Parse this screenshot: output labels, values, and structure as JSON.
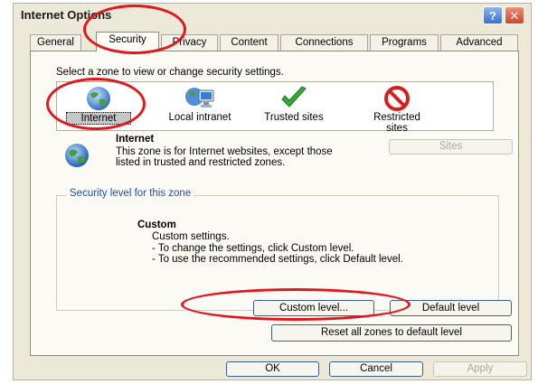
{
  "window": {
    "title": "Internet Options",
    "help_label": "?",
    "close_label": "✕"
  },
  "tabs": [
    {
      "label": "General"
    },
    {
      "label": "Security",
      "active": true
    },
    {
      "label": "Privacy"
    },
    {
      "label": "Content"
    },
    {
      "label": "Connections"
    },
    {
      "label": "Programs"
    },
    {
      "label": "Advanced"
    }
  ],
  "security": {
    "prompt": "Select a zone to view or change security settings.",
    "zones": [
      {
        "label": "Internet",
        "icon": "globe-icon",
        "selected": true
      },
      {
        "label": "Local intranet",
        "icon": "computer-network-icon"
      },
      {
        "label": "Trusted sites",
        "icon": "green-checkmark-icon"
      },
      {
        "label": "Restricted sites",
        "icon": "red-no-entry-icon"
      }
    ],
    "info_title": "Internet",
    "info_text": "This zone is for Internet websites, except those listed in trusted and restricted zones.",
    "sites_button": "Sites",
    "level_group_label": "Security level for this zone",
    "level_name": "Custom",
    "level_lines": [
      "Custom settings.",
      "- To change the settings, click Custom level.",
      "- To use the recommended settings, click Default level."
    ],
    "custom_level_button": "Custom level...",
    "default_level_button": "Default level",
    "reset_button": "Reset all zones to default level"
  },
  "footer": {
    "ok": "OK",
    "cancel": "Cancel",
    "apply": "Apply"
  },
  "colors": {
    "dialog_bg": "#ece9d8",
    "panel_bg": "#fbfaf5",
    "annotation_red": "#e0171d",
    "group_label": "#1a4fb5"
  }
}
